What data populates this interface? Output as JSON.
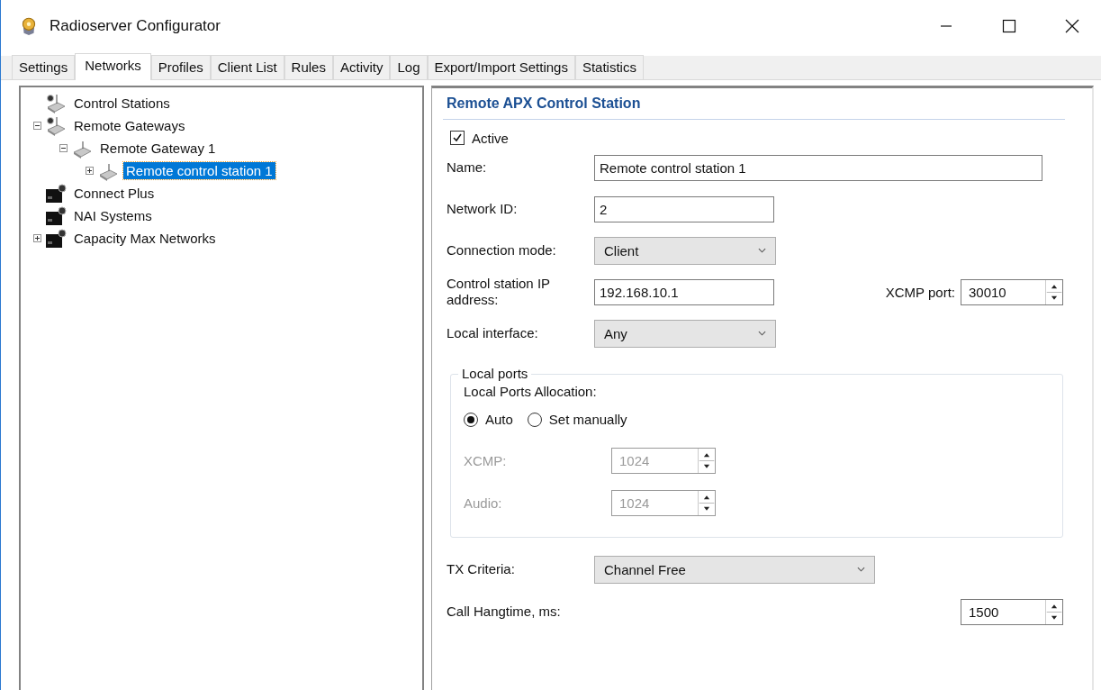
{
  "window": {
    "title": "Radioserver Configurator"
  },
  "tabs": [
    {
      "label": "Settings",
      "selected": false
    },
    {
      "label": "Networks",
      "selected": true
    },
    {
      "label": "Profiles",
      "selected": false
    },
    {
      "label": "Client List",
      "selected": false
    },
    {
      "label": "Rules",
      "selected": false
    },
    {
      "label": "Activity",
      "selected": false
    },
    {
      "label": "Log",
      "selected": false
    },
    {
      "label": "Export/Import Settings",
      "selected": false
    },
    {
      "label": "Statistics",
      "selected": false
    }
  ],
  "tree": [
    {
      "label": "Control Stations",
      "kind": "radio",
      "selected": false
    },
    {
      "label": "Remote Gateways",
      "kind": "radio",
      "selected": false,
      "expanded": true,
      "children": [
        {
          "label": "Remote Gateway 1",
          "kind": "gateway",
          "selected": false,
          "expanded": true,
          "children": [
            {
              "label": "Remote control station 1",
              "kind": "gateway",
              "selected": true,
              "expanded": false
            }
          ]
        }
      ]
    },
    {
      "label": "Connect Plus",
      "kind": "system",
      "selected": false
    },
    {
      "label": "NAI Systems",
      "kind": "system",
      "selected": false
    },
    {
      "label": "Capacity Max Networks",
      "kind": "system",
      "selected": false,
      "expanded": false
    }
  ],
  "panel": {
    "title": "Remote APX Control Station",
    "active": {
      "label": "Active",
      "checked": true
    },
    "rows": [
      {
        "kind": "wide-text",
        "label": "Name:",
        "value": "Remote control station 1"
      },
      {
        "kind": "text",
        "label": "Network ID:",
        "value": "2"
      },
      {
        "kind": "select",
        "label": "Connection mode:",
        "value": "Client"
      },
      {
        "kind": "text-with-port",
        "label": "Control station IP address:",
        "value": "192.168.10.1",
        "port_label": "XCMP port:",
        "port_value": "30010"
      },
      {
        "kind": "select",
        "label": "Local interface:",
        "value": "Any"
      }
    ],
    "local_ports": {
      "legend": "Local ports",
      "allocation_label": "Local Ports Allocation:",
      "options": [
        {
          "label": "Auto",
          "selected": true
        },
        {
          "label": "Set manually",
          "selected": false
        }
      ],
      "fields": [
        {
          "label": "XCMP:",
          "value": "1024",
          "disabled": true
        },
        {
          "label": "Audio:",
          "value": "1024",
          "disabled": true
        }
      ]
    },
    "tx_criteria": {
      "label": "TX Criteria:",
      "value": "Channel Free"
    },
    "call_hangtime": {
      "label": "Call Hangtime, ms:",
      "value": "1500"
    }
  }
}
